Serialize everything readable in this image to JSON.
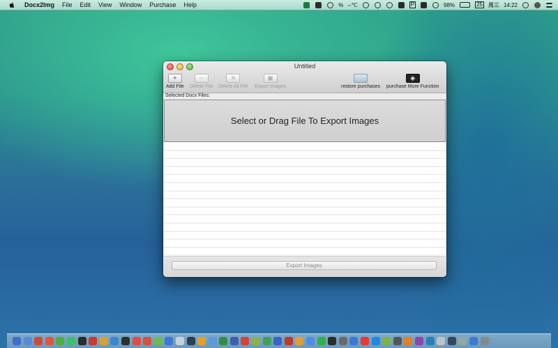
{
  "menubar": {
    "app_name": "Docx2Img",
    "items": [
      "File",
      "Edit",
      "View",
      "Window",
      "Purchase",
      "Help"
    ],
    "status": {
      "temp": "--℃",
      "percent_symbol": "%",
      "battery": "98%",
      "day": "周三",
      "time": "14:22",
      "calendar_day": "25",
      "input_letter": "P"
    }
  },
  "window": {
    "title": "Untitled",
    "toolbar": {
      "add_file": "Add File",
      "delete_file": "Delete File",
      "delete_all_file": "Delete All File",
      "export_images": "Export Images",
      "restore_purchases": "restore purchases",
      "purchase_more": "purchase More Function"
    },
    "section_label": "Selected Docx Files:",
    "dropzone_text": "Select or Drag File To Export Images",
    "export_button": "Export Images"
  },
  "colors": {
    "dock_icons": [
      "#3d6fd1",
      "#5b8bd6",
      "#d04a3a",
      "#e0563b",
      "#4fae3a",
      "#3fbf66",
      "#2b2b2b",
      "#c93a2e",
      "#d8a032",
      "#3a86d0",
      "#2f2f2f",
      "#e24c3b",
      "#d6523a",
      "#6bbd4a",
      "#3d78d8",
      "#c9d1da",
      "#2c3e50",
      "#e5a02a",
      "#5d9ad8",
      "#2f8f3f",
      "#3d5fb0",
      "#d0453a",
      "#8ab44a",
      "#3fa05a",
      "#3a64c8",
      "#c0392b",
      "#e0a030",
      "#4a90e2",
      "#2db24a",
      "#2b2b2b",
      "#6a6a6a",
      "#3c78d8",
      "#e53935",
      "#1e88e5",
      "#7cb342",
      "#555555",
      "#e67e22",
      "#8e44ad",
      "#2980b9",
      "#bdc3c7",
      "#34495e",
      "#95a5a6",
      "#3d7ad6",
      "#7f8c8d"
    ]
  }
}
